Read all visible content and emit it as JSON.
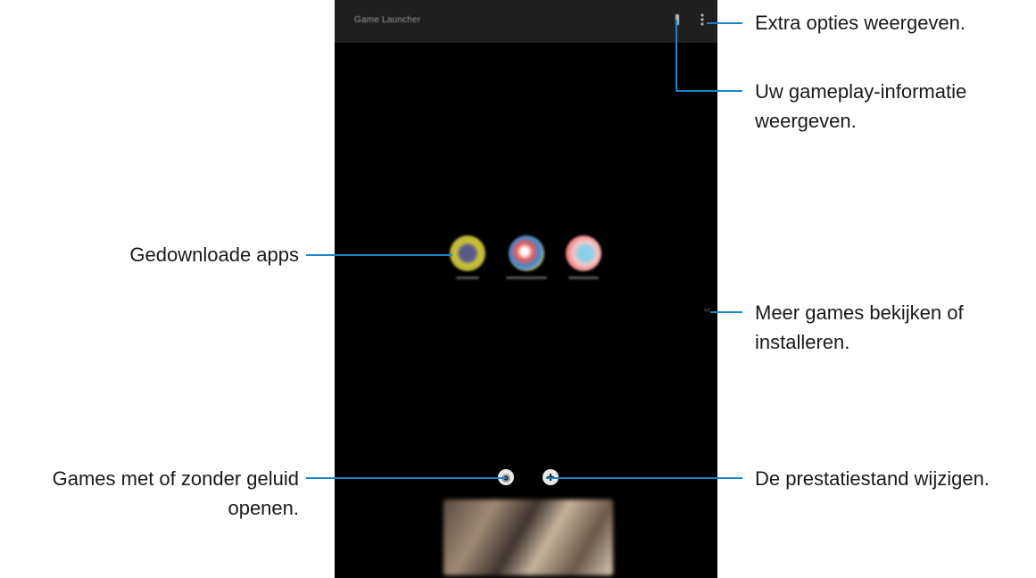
{
  "screen": {
    "title": "Game Launcher",
    "topbar_icons": [
      "gameplay-info-icon",
      "more-options-icon"
    ],
    "apps": [
      {
        "label": "",
        "color": "#c9c23a"
      },
      {
        "label": "",
        "color": "#e87a3a"
      },
      {
        "label": "",
        "color": "#f0a0a0"
      }
    ],
    "controls": [
      "mute-icon",
      "performance-icon"
    ]
  },
  "callouts": {
    "extra_options": "Extra opties weergeven.",
    "gameplay_info_1": "Uw gameplay-informatie",
    "gameplay_info_2": "weergeven.",
    "downloaded_apps": "Gedownloade apps",
    "more_games_1": "Meer games bekijken of",
    "more_games_2": "installeren.",
    "sound_1": "Games met of zonder geluid",
    "sound_2": "openen.",
    "performance": "De prestatiestand wijzigen."
  },
  "colors": {
    "callout_line": "#1a86c7",
    "screen_bg": "#000000"
  }
}
